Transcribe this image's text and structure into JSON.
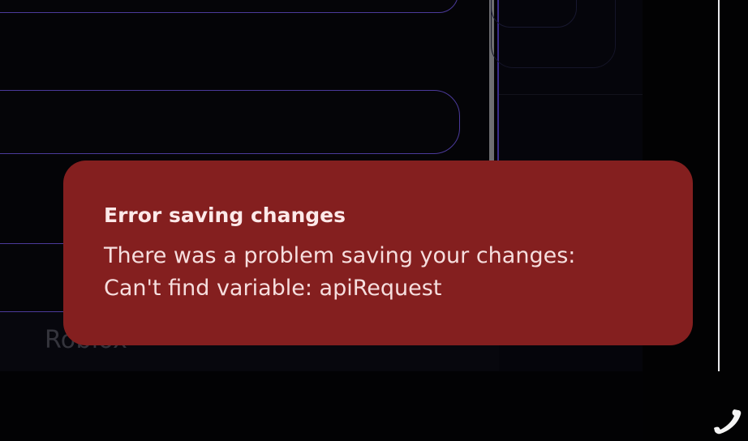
{
  "background_app": {
    "footer_label": "Roblox"
  },
  "toast": {
    "title": "Error saving changes",
    "message_line1": "There was a problem saving your changes:",
    "message_line2": "Can't find variable: apiRequest",
    "color": "#841f1f"
  },
  "accent_color": "#4b3a9a",
  "icons": {
    "corner": "phone-handset-icon"
  }
}
